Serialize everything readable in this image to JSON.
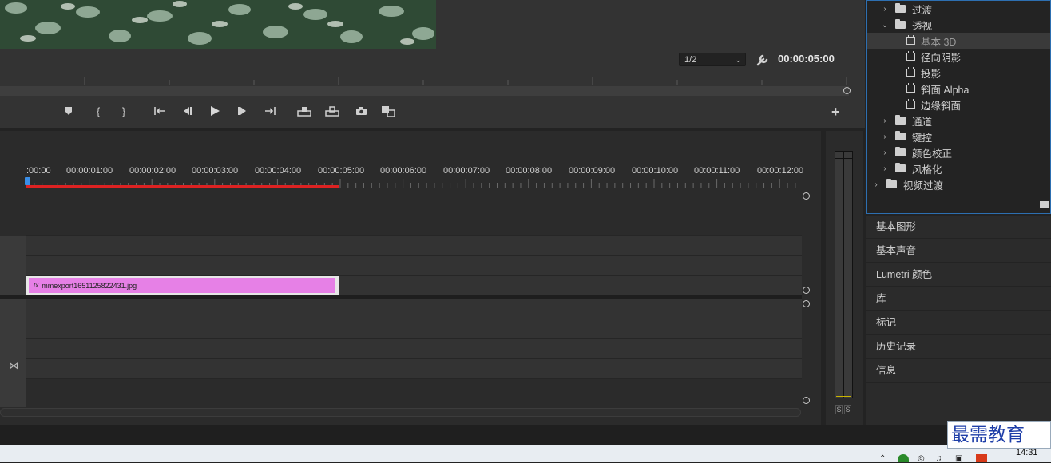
{
  "monitor": {
    "zoom": "1/2",
    "timecode": "00:00:05:00"
  },
  "timeline": {
    "ruler_labels": [
      ":00:00",
      "00:00:01:00",
      "00:00:02:00",
      "00:00:03:00",
      "00:00:04:00",
      "00:00:05:00",
      "00:00:06:00",
      "00:00:07:00",
      "00:00:08:00",
      "00:00:09:00",
      "00:00:10:00",
      "00:00:11:00",
      "00:00:12:00"
    ],
    "clip_name": "mmexport1651125822431.jpg",
    "clip_badge": "fx"
  },
  "effects": {
    "items": [
      {
        "label": "过渡",
        "kind": "folder",
        "expanded": false
      },
      {
        "label": "透视",
        "kind": "folder",
        "expanded": true
      },
      {
        "label": "基本 3D",
        "kind": "preset",
        "selected": true
      },
      {
        "label": "径向阴影",
        "kind": "preset"
      },
      {
        "label": "投影",
        "kind": "preset"
      },
      {
        "label": "斜面 Alpha",
        "kind": "preset"
      },
      {
        "label": "边缘斜面",
        "kind": "preset"
      },
      {
        "label": "通道",
        "kind": "folder",
        "expanded": false
      },
      {
        "label": "键控",
        "kind": "folder",
        "expanded": false
      },
      {
        "label": "颜色校正",
        "kind": "folder",
        "expanded": false
      },
      {
        "label": "风格化",
        "kind": "folder",
        "expanded": false
      },
      {
        "label": "视频过渡",
        "kind": "folder",
        "expanded": false,
        "top": true
      }
    ]
  },
  "panels": [
    "基本图形",
    "基本声音",
    "Lumetri 颜色",
    "库",
    "标记",
    "历史记录",
    "信息"
  ],
  "meter": {
    "solo_left": "S",
    "solo_right": "S"
  },
  "watermark": "最需教育",
  "clock": "14:31",
  "colors": {
    "accent": "#2d6fb1",
    "clip": "#e680e6",
    "work_area": "#dd2222",
    "playhead": "#3a8ee6"
  }
}
